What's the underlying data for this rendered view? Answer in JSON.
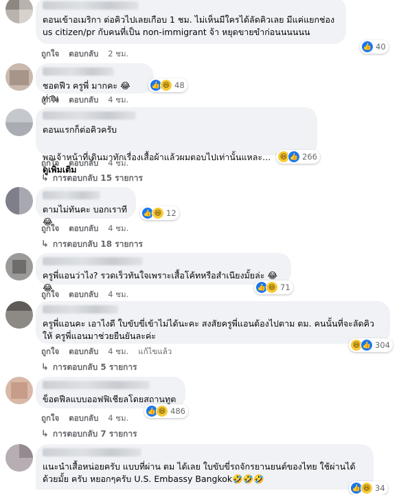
{
  "actions": {
    "like": "ถูกใจ",
    "reply": "ตอบกลับ",
    "edited": "แก้ไขแล้ว"
  },
  "comments": [
    {
      "text": "ตอนเข้าอเมริกา ต่อคิวไปเลยเกือบ 1 ชม. ไม่เห็นมีใครได้ลัดคิวเลย มีแค่แยกช่อง us citizen/pr กับคนที่เป็น non-immigrant จ้า หยุดขายขำก่อนนนนนน",
      "timestamp": "2 ชม.",
      "reaction_count": "40",
      "reactions": [
        "like"
      ]
    },
    {
      "text": "ชอตฟีว ครูพี่ มากคะ 😂 ท่าน",
      "timestamp": "4 ชม.",
      "reaction_count": "48",
      "reactions": [
        "like",
        "haha"
      ]
    },
    {
      "text": "ตอนแรกก็ต่อคิวครับ",
      "text2": "พอเจ้าหน้าที่เดินมาทักเรื่องเสื้อผ้าแล้วผมตอบไปเท่านั้นแหละ...",
      "see_more": "ดูเพิ่มเติม",
      "timestamp": "4 ชม.",
      "reaction_count": "266",
      "reactions": [
        "haha",
        "like"
      ],
      "replies": "การตอบกลับ 15 รายการ"
    },
    {
      "text": "ตามไม่ทันคะ บอกเราที 😂",
      "timestamp": "4 ชม.",
      "reaction_count": "12",
      "reactions": [
        "like",
        "haha"
      ],
      "replies": "การตอบกลับ 18 รายการ"
    },
    {
      "text": "ครูพี่แอนว่าไง? รวดเร็วทันใจเพราะเสื้อโค้ทหรือสำเนียงมั้ยล่ะ 😂😂",
      "timestamp": "4 ชม.",
      "reaction_count": "71",
      "reactions": [
        "like",
        "haha"
      ]
    },
    {
      "text": "ครูพี่แอนคะ เอาไงดี ใบขับขี่เข้าไม่ได้นะคะ สงสัยครูพี่แอนต้องไปตาม ตม. คนนั้นที่จะลัดคิวให้ ครูพี่แอนมาช่วยยืนยันละค่ะ",
      "timestamp": "4 ชม.",
      "reaction_count": "304",
      "reactions": [
        "haha",
        "like"
      ],
      "edited": true,
      "replies": "การตอบกลับ 5 รายการ"
    },
    {
      "text": "ข็อตฟีลแบบออฟฟิเชียลโดยสถานทูต",
      "timestamp": "4 ชม.",
      "reaction_count": "486",
      "reactions": [
        "like",
        "haha"
      ],
      "replies": "การตอบกลับ 7 รายการ"
    },
    {
      "text": "แนะนำเสื้อหน่อยครับ แบบที่ผ่าน ตม ได้เลย ใบขับขี่รถจักรยานยนต์ของไทย ใช้ผ่านได้ด้วยมั้ย ครับ หยอกๆครับ U.S. Embassy Bangkok🤣🤣🤣",
      "reaction_count": "34",
      "reactions": [
        "like",
        "haha"
      ]
    }
  ],
  "icons": {
    "like": "thumbs-up-icon",
    "haha": "laughing-face-icon",
    "reply_arrow": "reply-arrow-icon"
  },
  "colors": {
    "bubble": "#f0f2f5",
    "like": "#1877f2",
    "haha": "#f7c934",
    "meta": "#65676b"
  }
}
